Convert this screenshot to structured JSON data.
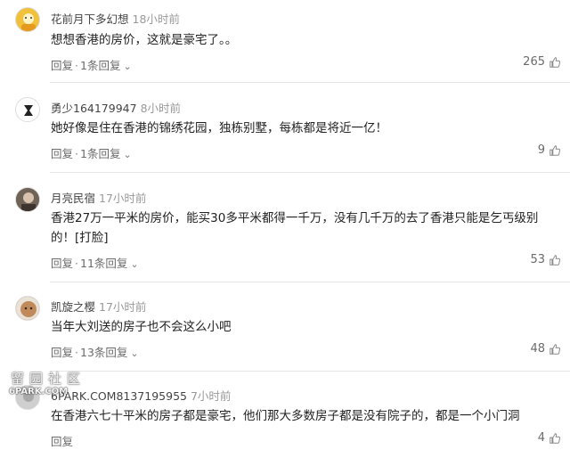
{
  "comments": [
    {
      "user": "花前月下多幻想",
      "time": "18小时前",
      "text": "想想香港的房价，这就是豪宅了。。",
      "reply_label": "回复",
      "sep": "·",
      "replies": "1条回复",
      "likes": "265",
      "avatar_color": "#f2c13b"
    },
    {
      "user": "勇少164179947",
      "time": "8小时前",
      "text": "她好像是住在香港的锦绣花园，独栋别墅，每栋都是将近一亿！",
      "reply_label": "回复",
      "sep": "·",
      "replies": "1条回复",
      "likes": "9",
      "avatar_color": "#1a1a1a"
    },
    {
      "user": "月亮民宿",
      "time": "17小时前",
      "text": "香港27万一平米的房价，能买30多平米都得一千万，没有几千万的去了香港只能是乞丐级别的！[打脸]",
      "reply_label": "回复",
      "sep": "·",
      "replies": "11条回复",
      "likes": "53",
      "avatar_color": "#8a7a6a"
    },
    {
      "user": "凯旋之樱",
      "time": "17小时前",
      "text": "当年大刘送的房子也不会这么小吧",
      "reply_label": "回复",
      "sep": "·",
      "replies": "13条回复",
      "likes": "48",
      "avatar_color": "#b07a52"
    },
    {
      "user": "6PARK.COM8137195955",
      "time": "7小时前",
      "text": "在香港六七十平米的房子都是豪宅，他们那大多数房子都是没有院子的，都是一个小门洞",
      "reply_label": "回复",
      "likes": "4",
      "avatar_color": "#c9c9c9"
    }
  ],
  "watermark": {
    "cn": "留园社区",
    "en": "6PARK.COM"
  }
}
